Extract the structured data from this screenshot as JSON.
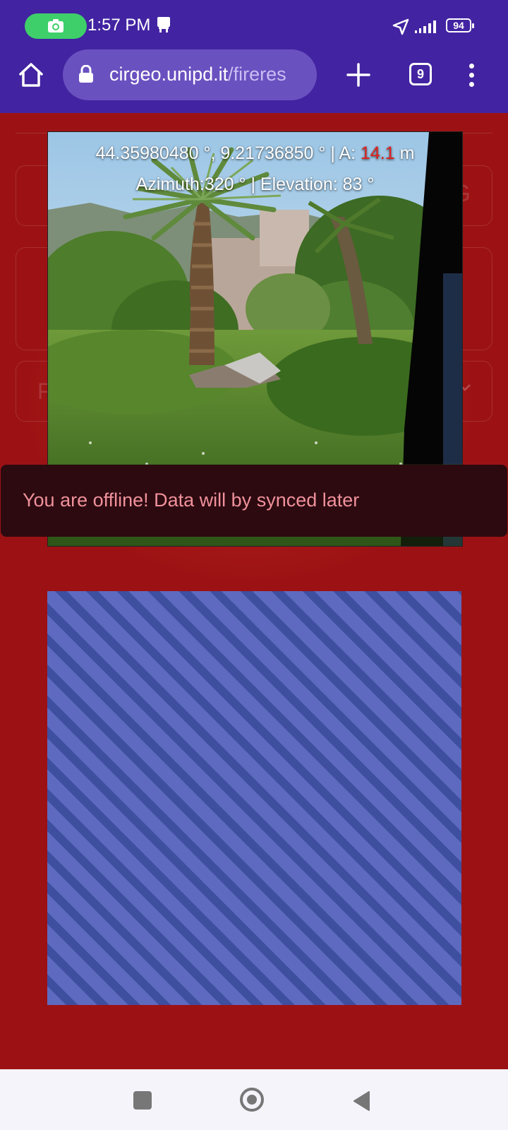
{
  "status_bar": {
    "time": "1:57 PM",
    "battery": "94",
    "icons": [
      "camera-icon",
      "clipboard-icon",
      "location-arrow-icon",
      "signal-icon",
      "battery-icon"
    ]
  },
  "browser": {
    "url_domain": "cirgeo.unipd.it",
    "url_path": "/fireres",
    "tab_count": "9",
    "icons": [
      "home-icon",
      "lock-icon",
      "plus-icon",
      "tabs-icon",
      "more-vert-icon"
    ]
  },
  "form_fields": [
    {
      "left_text": "",
      "right_text": "G"
    },
    {
      "left_text": "",
      "right_text": ""
    },
    {
      "left_text": "F",
      "right_text": ""
    }
  ],
  "photo_overlay": {
    "coords": "44.35980480 °, 9.21736850 ° | A: ",
    "altitude_value": "14.1",
    "altitude_unit": " m",
    "orientation": "Azimuth:320 ° |  Elevation: 83 °"
  },
  "snackbar": {
    "message": "You are offline! Data will by synced later"
  },
  "colors": {
    "page_bg": "#9c1214",
    "toolbar_bg": "#4223a1",
    "snackbar_bg": "#2c0a10",
    "snackbar_text": "#f0919b",
    "altitude_highlight": "#e0211d",
    "stripe_light": "#5e6ac0",
    "stripe_dark": "#3f4fa0"
  },
  "nav_bar": {
    "icons": [
      "recents-square-icon",
      "home-circle-icon",
      "back-triangle-icon"
    ]
  }
}
